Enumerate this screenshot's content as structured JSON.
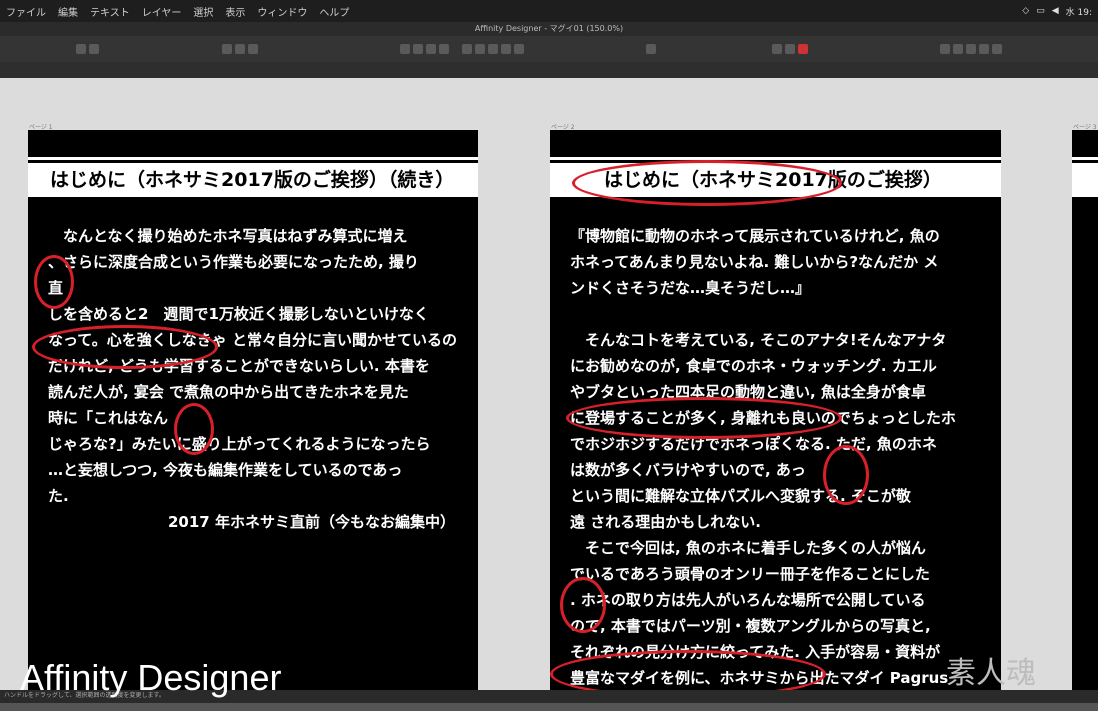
{
  "menubar": {
    "items": [
      "ファイル",
      "編集",
      "テキスト",
      "レイヤー",
      "選択",
      "表示",
      "ウィンドウ",
      "ヘルプ"
    ],
    "clock": "水 19:"
  },
  "window": {
    "title": "Affinity Designer - マグイ01 (150.0%)"
  },
  "canvas": {
    "page1": {
      "label": "ページ 1",
      "heading": "はじめに（ホネサミ2017版のご挨拶）（続き）",
      "body": "　なんとなく撮り始めたホネ写真はねずみ算式に増え\n、さらに深度合成という作業も必要になったため, 撮り\n直\nしを含めると2　週間で1万枚近く撮影しないといけなく\nなって。心を強くしなきゃ と常々自分に言い聞かせているの\nだけれど, どうも学習することができないらしい. 本書を\n読んだ人が, 宴会 で煮魚の中から出てきたホネを見た\n時に「これはなん\nじゃろな?」みたいに盛り上がってくれるようになったら\n…と妄想しつつ, 今夜も編集作業をしているのであっ\nた.",
      "signature": "2017 年ホネサミ直前（今もなお編集中）"
    },
    "page2": {
      "label": "ページ 2",
      "heading": "はじめに（ホネサミ2017版のご挨拶）",
      "body": "『博物館に動物のホネって展示されているけれど, 魚の\nホネってあんまり見ないよね. 難しいから?なんだか メ\nンドくさそうだな…臭そうだし…』\n\n　そんなコトを考えている, そこのアナタ!そんなアナタ\nにお勧めなのが, 食卓でのホネ・ウォッチング. カエル\nやブタといった四本足の動物と違い, 魚は全身が食卓\nに登場することが多く, 身離れも良いのでちょっとしたホ\nでホジホジするだけでホネっぽくなる. ただ, 魚のホネ\nは数が多くバラけやすいので, あっ\nという間に難解な立体パズルへ変貌する. そこが敬\n遠 される理由かもしれない.\n　そこで今回は, 魚のホネに着手した多くの人が悩ん\nでいるであろう頭骨のオンリー冊子を作ることにした\n. ホネの取り方は先人がいろんな場所で公開している\nので, 本書ではパーツ別・複数アングルからの写真と,\nそれぞれの見分け方に絞ってみた. 入手が容易・資料が\n豊富なマダイを例に、ホネサミから出たマダイ Pagrus"
    },
    "page3": {
      "label": "ページ 3"
    }
  },
  "statusbar": {
    "hint": "ハンドルをドラッグして、選択範囲の透明度を変更します。"
  },
  "watermark": "Affinity Designer",
  "stamp": "素人魂"
}
